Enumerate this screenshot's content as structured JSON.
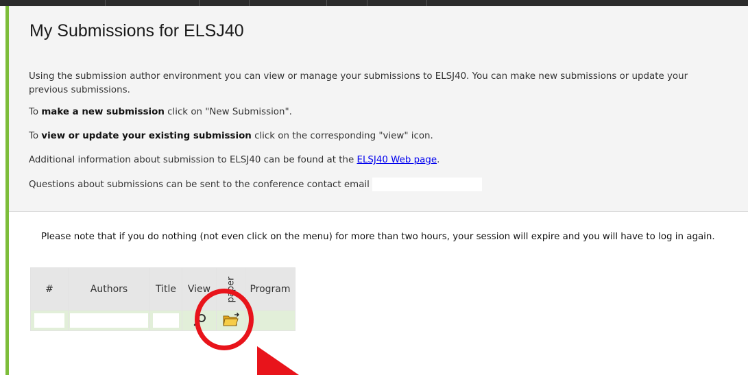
{
  "page": {
    "title": "My Submissions for ELSJ40"
  },
  "intro": {
    "p1": "Using the submission author environment you can view or manage your submissions to ELSJ40. You can make new submissions or update your previous submissions.",
    "p2_pre": "To ",
    "p2_bold": "make a new submission",
    "p2_post": " click on \"New Submission\".",
    "p3_pre": "To ",
    "p3_bold": "view or update your existing submission",
    "p3_post": " click on the corresponding \"view\" icon.",
    "p4_pre": "Additional information about submission to ELSJ40 can be found at the ",
    "p4_link": "ELSJ40 Web page",
    "p4_post": ".",
    "p5": "Questions about submissions can be sent to the conference contact email"
  },
  "notice": "Please note that if you do nothing (not even click on the menu) for more than two hours, your session will expire and you will have to log in again.",
  "table": {
    "headers": {
      "num": "#",
      "authors": "Authors",
      "title": "Title",
      "view": "View",
      "paper": "paper",
      "program": "Program"
    },
    "rows": [
      {
        "num": "",
        "authors": "",
        "title": "",
        "view_icon": "magnifier-icon",
        "paper_icon": "folder-update-icon",
        "program": ""
      }
    ]
  },
  "annotation": {
    "circle_color": "#e8141b",
    "arrow_color": "#e8141b"
  },
  "colors": {
    "accent_green": "#7dbd3a",
    "header_bg": "#f4f4f4",
    "row_bg": "#e2efd9",
    "link": "#0000ee"
  }
}
